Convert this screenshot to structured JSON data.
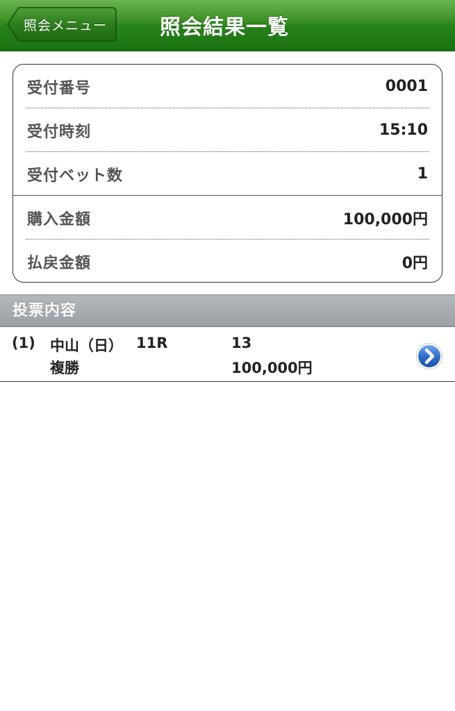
{
  "navbar": {
    "back_label": "照会メニュー",
    "title": "照会結果一覧"
  },
  "summary": {
    "rows": [
      {
        "label": "受付番号",
        "value": "0001"
      },
      {
        "label": "受付時刻",
        "value": "15:10"
      },
      {
        "label": "受付ベット数",
        "value": "1"
      },
      {
        "label": "購入金額",
        "value": "100,000円"
      },
      {
        "label": "払戻金額",
        "value": "0円"
      }
    ]
  },
  "section": {
    "title": "投票内容"
  },
  "tickets": [
    {
      "index": "(1)",
      "venue": "中山（日）",
      "race": "11R",
      "horse": "13",
      "bet_type": "複勝",
      "amount": "100,000円"
    }
  ],
  "icons": {
    "back": "chevron-left-icon",
    "disclosure": "chevron-right-circle-icon"
  },
  "colors": {
    "navbar_green": "#27821a",
    "section_gray": "#a3a9ae",
    "disclosure_blue": "#2f6fd0"
  }
}
